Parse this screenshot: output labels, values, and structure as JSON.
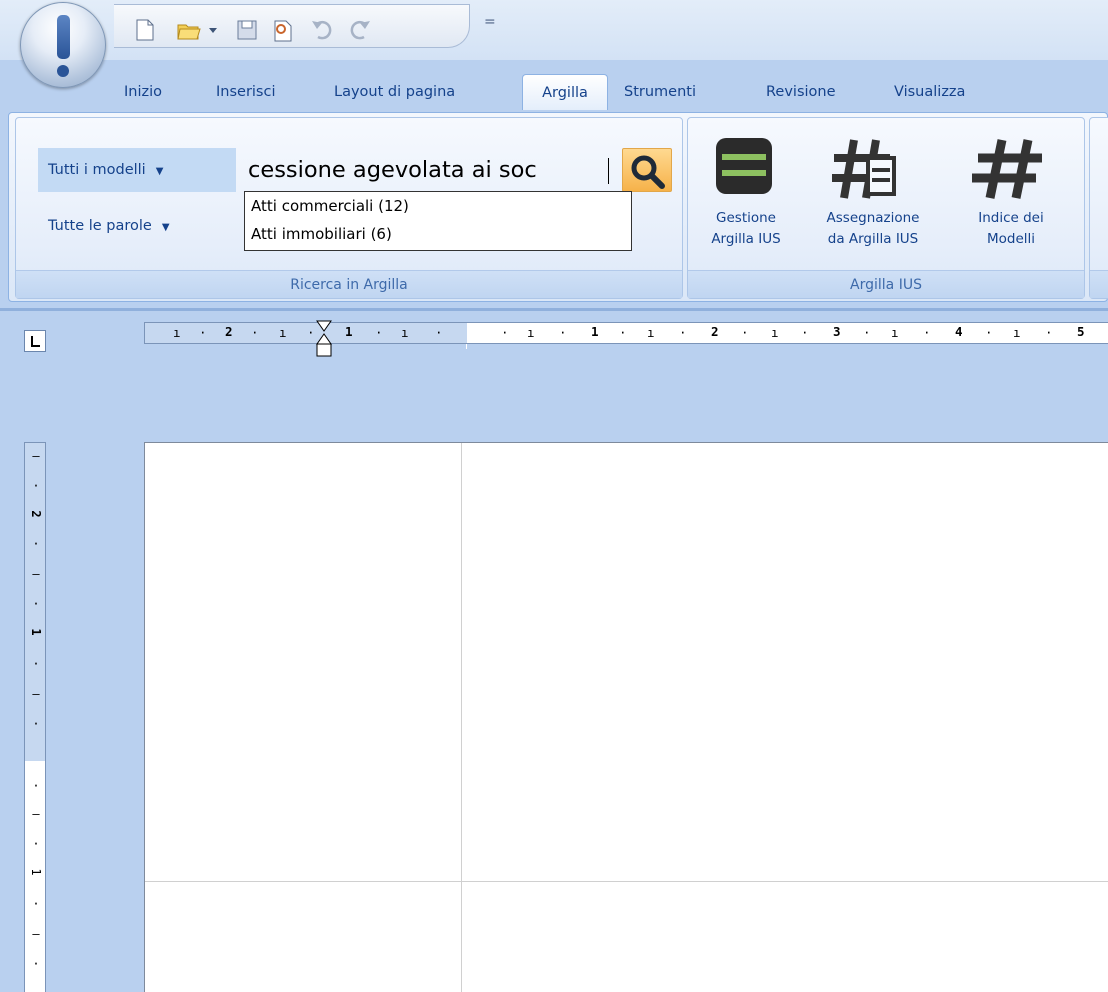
{
  "quick_access": {
    "icons": [
      "new-document-icon",
      "open-folder-icon",
      "dropdown-arrow-icon",
      "save-icon",
      "print-preview-icon",
      "undo-icon",
      "redo-icon"
    ],
    "more": "="
  },
  "tabs": [
    {
      "label": "Inizio"
    },
    {
      "label": "Inserisci"
    },
    {
      "label": "Layout di pagina"
    },
    {
      "label": "Argilla",
      "active": true
    },
    {
      "label": "Strumenti"
    },
    {
      "label": "Revisione"
    },
    {
      "label": "Visualizza"
    }
  ],
  "search_group": {
    "scope": "Tutti i modelli",
    "words": "Tutte le parole",
    "query": "cessione agevolata ai soc",
    "label": "Ricerca in Argilla",
    "suggestions": [
      "Atti commerciali (12)",
      "Atti immobiliari (6)"
    ]
  },
  "argilla_ius_group": {
    "label": "Argilla IUS",
    "buttons": [
      {
        "line1": "Gestione",
        "line2": "Argilla IUS",
        "icon": "gestione-icon"
      },
      {
        "line1": "Assegnazione",
        "line2": "da Argilla IUS",
        "icon": "hash-document-icon"
      },
      {
        "line1": "Indice dei",
        "line2": "Modelli",
        "icon": "hash-icon"
      }
    ]
  },
  "ruler": {
    "h_ticks": [
      "2",
      "1",
      "1",
      "2",
      "3",
      "4",
      "5"
    ],
    "v_ticks": [
      "2",
      "1",
      "1"
    ]
  },
  "colors": {
    "accent": "#15428b",
    "search_button": "#f6b24a",
    "ribbon_bg": "#dbe7f7",
    "workspace_bg": "#b9d0ef"
  }
}
